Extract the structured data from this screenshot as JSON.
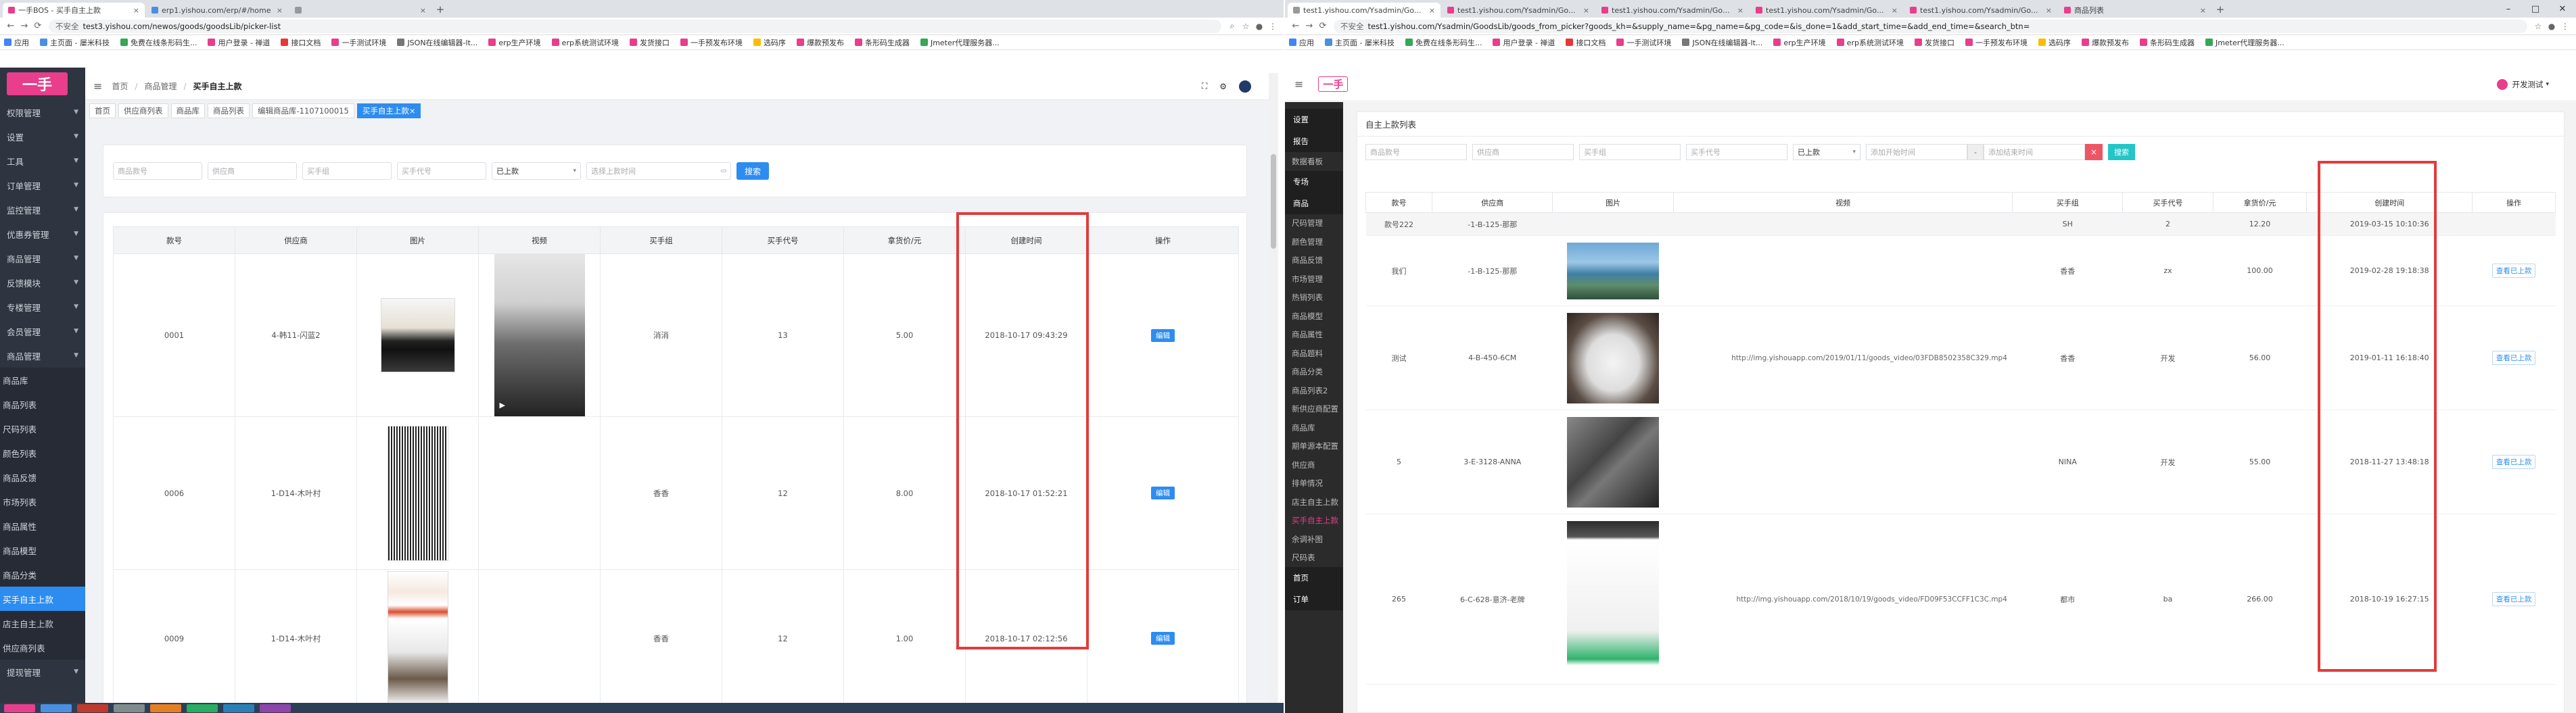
{
  "left": {
    "tabs": [
      {
        "title": "一手BOS - 买手自主上款",
        "color": "#e83e8c",
        "active": true
      },
      {
        "title": "erp1.yishou.com/erp/#/home",
        "color": "#4a90e2",
        "active": false
      },
      {
        "title": "",
        "color": "#999",
        "active": false
      }
    ],
    "url_insecure": "不安全",
    "url": "test3.yishou.com/newos/goods/goodsLib/picker-list",
    "bookmarks": [
      {
        "label": "应用",
        "color": "#4285f4"
      },
      {
        "label": "主页面 - 屡米科技",
        "color": "#4a90e2"
      },
      {
        "label": "免费在线条形码生...",
        "color": "#34a853"
      },
      {
        "label": "用户登录 - 禅道",
        "color": "#e83e8c"
      },
      {
        "label": "接口文档",
        "color": "#e53935"
      },
      {
        "label": "一手测试环境",
        "color": "#e83e8c"
      },
      {
        "label": "JSON在线编辑器-lt...",
        "color": "#777"
      },
      {
        "label": "erp生产环境",
        "color": "#e83e8c"
      },
      {
        "label": "erp系统测试环境",
        "color": "#e83e8c"
      },
      {
        "label": "发货接口",
        "color": "#e83e8c"
      },
      {
        "label": "一手预发布环境",
        "color": "#e83e8c"
      },
      {
        "label": "选码序",
        "color": "#fbbc05"
      },
      {
        "label": "爆款预发布",
        "color": "#e83e8c"
      },
      {
        "label": "条形码生成器",
        "color": "#e83e8c"
      },
      {
        "label": "Jmeter代理服务器...",
        "color": "#34a853"
      }
    ],
    "logo": "一手",
    "menu": [
      {
        "label": "权限管理"
      },
      {
        "label": "设置"
      },
      {
        "label": "工具"
      },
      {
        "label": "订单管理"
      },
      {
        "label": "监控管理"
      },
      {
        "label": "优惠券管理"
      },
      {
        "label": "商品管理"
      },
      {
        "label": "反馈模块"
      },
      {
        "label": "专楼管理"
      },
      {
        "label": "会员管理"
      },
      {
        "label": "商品管理"
      }
    ],
    "submenu": [
      {
        "label": "商品库",
        "active": false
      },
      {
        "label": "商品列表",
        "active": false
      },
      {
        "label": "尺码列表",
        "active": false
      },
      {
        "label": "颜色列表",
        "active": false
      },
      {
        "label": "商品反馈",
        "active": false
      },
      {
        "label": "市场列表",
        "active": false
      },
      {
        "label": "商品属性",
        "active": false
      },
      {
        "label": "商品模型",
        "active": false
      },
      {
        "label": "商品分类",
        "active": false
      },
      {
        "label": "买手自主上款",
        "active": true
      },
      {
        "label": "店主自主上款",
        "active": false
      },
      {
        "label": "供应商列表",
        "active": false
      }
    ],
    "menu_after": [
      {
        "label": "提现管理"
      }
    ],
    "breadcrumb": [
      "首页",
      "商品管理",
      "买手自主上款"
    ],
    "tags": [
      {
        "label": "首页",
        "active": false
      },
      {
        "label": "供应商列表",
        "active": false
      },
      {
        "label": "商品库",
        "active": false
      },
      {
        "label": "商品列表",
        "active": false
      },
      {
        "label": "编辑商品库-1107100015",
        "active": false
      },
      {
        "label": "买手自主上款",
        "active": true
      }
    ],
    "filters": {
      "f1": "商品款号",
      "f2": "供应商",
      "f3": "买手组",
      "f4": "买手代号",
      "status": "已上款",
      "date": "选择上款时间",
      "search": "搜索"
    },
    "table": {
      "headers": [
        "款号",
        "供应商",
        "图片",
        "视频",
        "买手组",
        "买手代号",
        "拿货价/元",
        "创建时间",
        "操作"
      ],
      "rows": [
        {
          "code": "0001",
          "supplier": "4-韩11-闪蓝2",
          "group": "消消",
          "buyer": "13",
          "price": "5.00",
          "time": "2018-10-17 09:43:29",
          "action": "编辑"
        },
        {
          "code": "0006",
          "supplier": "1-D14-木叶村",
          "group": "香香",
          "buyer": "12",
          "price": "8.00",
          "time": "2018-10-17 01:52:21",
          "action": "编辑"
        },
        {
          "code": "0009",
          "supplier": "1-D14-木叶村",
          "group": "香香",
          "buyer": "12",
          "price": "1.00",
          "time": "2018-10-17 02:12:56",
          "action": "编辑"
        }
      ]
    }
  },
  "right": {
    "tabs": [
      {
        "title": "test1.yishou.com/Ysadmin/Go...",
        "color": "#999",
        "active": true
      },
      {
        "title": "test1.yishou.com/Ysadmin/Go...",
        "color": "#e83e8c",
        "active": false
      },
      {
        "title": "test1.yishou.com/Ysadmin/Go...",
        "color": "#e83e8c",
        "active": false
      },
      {
        "title": "test1.yishou.com/Ysadmin/Go...",
        "color": "#e83e8c",
        "active": false
      },
      {
        "title": "test1.yishou.com/Ysadmin/Go...",
        "color": "#e83e8c",
        "active": false
      },
      {
        "title": "商品列表",
        "color": "#e83e8c",
        "active": false
      }
    ],
    "url_insecure": "不安全",
    "url": "test1.yishou.com/Ysadmin/GoodsLib/goods_from_picker?goods_kh=&supply_name=&pg_name=&pg_code=&is_done=1&add_start_time=&add_end_time=&search_btn=",
    "bookmarks": [
      {
        "label": "应用",
        "color": "#4285f4"
      },
      {
        "label": "主页面 - 屡米科技",
        "color": "#4a90e2"
      },
      {
        "label": "免费在线条形码生...",
        "color": "#34a853"
      },
      {
        "label": "用户登录 - 禅道",
        "color": "#e83e8c"
      },
      {
        "label": "接口文档",
        "color": "#e53935"
      },
      {
        "label": "一手测试环境",
        "color": "#e83e8c"
      },
      {
        "label": "JSON在线编辑器-lt...",
        "color": "#777"
      },
      {
        "label": "erp生产环境",
        "color": "#e83e8c"
      },
      {
        "label": "erp系统测试环境",
        "color": "#e83e8c"
      },
      {
        "label": "发货接口",
        "color": "#e83e8c"
      },
      {
        "label": "一手预发布环境",
        "color": "#e83e8c"
      },
      {
        "label": "选码序",
        "color": "#fbbc05"
      },
      {
        "label": "爆款预发布",
        "color": "#e83e8c"
      },
      {
        "label": "条形码生成器",
        "color": "#e83e8c"
      },
      {
        "label": "Jmeter代理服务器...",
        "color": "#34a853"
      }
    ],
    "logo": "一手",
    "user": "开发测试",
    "menu": [
      {
        "label": "设置",
        "type": "section"
      },
      {
        "label": "报告",
        "type": "section"
      },
      {
        "label": "数据看板",
        "type": "item"
      },
      {
        "label": "专场",
        "type": "section"
      },
      {
        "label": "商品",
        "type": "section"
      },
      {
        "label": "尺码管理",
        "type": "item"
      },
      {
        "label": "颜色管理",
        "type": "item"
      },
      {
        "label": "商品反馈",
        "type": "item"
      },
      {
        "label": "市场管理",
        "type": "item"
      },
      {
        "label": "热销列表",
        "type": "item"
      },
      {
        "label": "商品模型",
        "type": "item"
      },
      {
        "label": "商品属性",
        "type": "item"
      },
      {
        "label": "商品题料",
        "type": "item"
      },
      {
        "label": "商品分类",
        "type": "item"
      },
      {
        "label": "商品列表2",
        "type": "item"
      },
      {
        "label": "新供应商配置",
        "type": "item"
      },
      {
        "label": "商品库",
        "type": "item"
      },
      {
        "label": "期单源本配置",
        "type": "item"
      },
      {
        "label": "供应商",
        "type": "item"
      },
      {
        "label": "排单情况",
        "type": "item"
      },
      {
        "label": "店主自主上款",
        "type": "item"
      },
      {
        "label": "买手自主上款",
        "type": "active"
      },
      {
        "label": "余调补图",
        "type": "item"
      },
      {
        "label": "尺码表",
        "type": "item"
      },
      {
        "label": "首页",
        "type": "section"
      },
      {
        "label": "订单",
        "type": "section"
      }
    ],
    "panel_title": "自主上款列表",
    "filters": {
      "f1": "商品款号",
      "f2": "供应商",
      "f3": "买手组",
      "f4": "买手代号",
      "status": "已上款",
      "start": "添加开始时间",
      "sep": "-",
      "end": "添加结束时间",
      "clear": "×",
      "search": "搜索"
    },
    "table": {
      "headers": [
        "款号",
        "供应商",
        "图片",
        "视频",
        "买手组",
        "买手代号",
        "拿货价/元",
        "创建时间",
        "操作"
      ],
      "rows": [
        {
          "code": "款号222",
          "supplier": "-1-B-125-那那",
          "video": "",
          "group": "SH",
          "buyer": "2",
          "price": "12.20",
          "time": "2019-03-15 10:10:36",
          "action": "",
          "img": ""
        },
        {
          "code": "我们",
          "supplier": "-1-B-125-那那",
          "video": "",
          "group": "香香",
          "buyer": "zx",
          "price": "100.00",
          "time": "2019-02-28 19:18:38",
          "action": "查看已上款",
          "img": "beach"
        },
        {
          "code": "测试",
          "supplier": "4-B-450-6CM",
          "video": "http://img.yishouapp.com/2019/01/11/goods_video/03FDB8502358C329.mp4",
          "group": "香香",
          "buyer": "开发",
          "price": "56.00",
          "time": "2019-01-11 16:18:40",
          "action": "查看已上款",
          "img": "mask"
        },
        {
          "code": "5",
          "supplier": "3-E-3128-ANNA",
          "video": "",
          "group": "NINA",
          "buyer": "开发",
          "price": "55.00",
          "time": "2018-11-27 13:48:18",
          "action": "查看已上款",
          "img": "dark"
        },
        {
          "code": "265",
          "supplier": "6-C-628-意济-老牌",
          "video": "http://img.yishouapp.com/2018/10/19/goods_video/FD09F53CCFF1C3C.mp4",
          "group": "都市",
          "buyer": "ba",
          "price": "266.00",
          "time": "2018-10-19 16:27:15",
          "action": "查看已上款",
          "img": "phone"
        }
      ]
    }
  }
}
